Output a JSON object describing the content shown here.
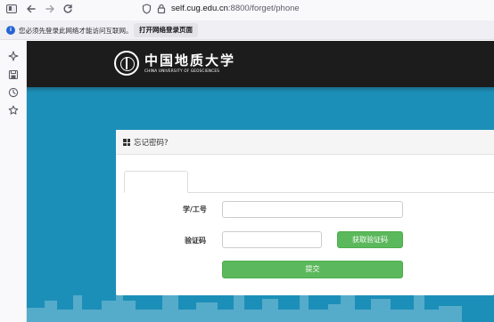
{
  "browser": {
    "url_host": "self.cug.edu.cn",
    "url_rest": ":8800/forget/phone"
  },
  "notification": {
    "message": "您必须先登录此网络才能访问互联网。",
    "button_label": "打开网络登录页面"
  },
  "logo": {
    "name_cn": "中国地质大学",
    "name_en": "CHINA UNIVERSITY OF GEOSCIENCES"
  },
  "card": {
    "title": "忘记密码?"
  },
  "form": {
    "id_label": "学/工号",
    "id_value": "",
    "code_label": "验证码",
    "code_value": "",
    "get_code_label": "获取验证码",
    "submit_label": "提交"
  },
  "colors": {
    "page_bg": "#1c8fb8",
    "header_bg": "#1c1c1c",
    "button_green": "#5cb85c"
  }
}
